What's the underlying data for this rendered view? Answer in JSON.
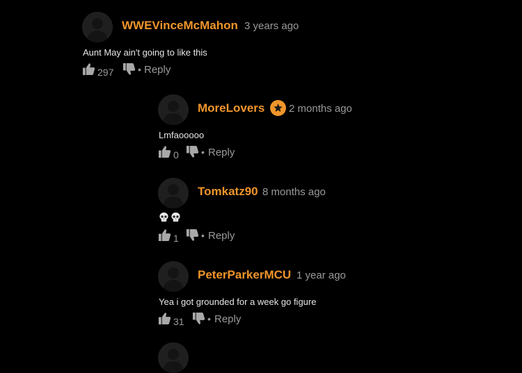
{
  "comments": [
    {
      "username": "WWEVinceMcMahon",
      "timestamp": "3 years ago",
      "text": "Aunt May ain't going to like this",
      "likes": "297",
      "reply_label": "Reply",
      "dot": "•"
    },
    {
      "username": "MoreLovers",
      "timestamp": "2 months ago",
      "text": "Lmfaooooo",
      "likes": "0",
      "reply_label": "Reply",
      "dot": "•",
      "badge": "star-badge-icon"
    },
    {
      "username": "Tomkatz90",
      "timestamp": "8 months ago",
      "text": "",
      "emojis": [
        "skull-emoji",
        "skull-emoji"
      ],
      "likes": "1",
      "reply_label": "Reply",
      "dot": "•"
    },
    {
      "username": "PeterParkerMCU",
      "timestamp": "1 year ago",
      "text": "Yea i got grounded for a week go figure",
      "likes": "31",
      "reply_label": "Reply",
      "dot": "•"
    }
  ],
  "colors": {
    "background": "#000000",
    "username": "#f0952a",
    "muted": "#9a9a9a",
    "text": "#e6e6e6",
    "avatar": "#1f1f1f"
  }
}
